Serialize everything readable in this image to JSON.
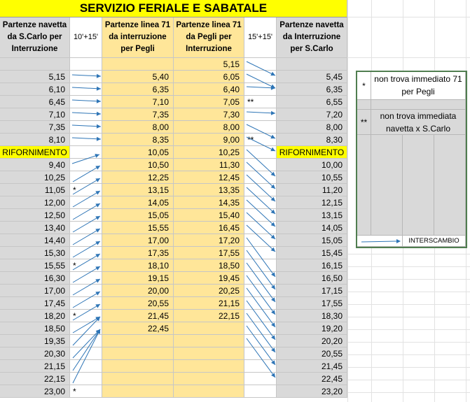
{
  "title": "SERVIZIO FERIALE E SABATALE",
  "headers": {
    "navetta_scarlo": "Partenze navetta da S.Carlo per Interruzione",
    "gap1": "10'+15'",
    "linea71_interruzione": "Partenze linea 71 da interruzione per Pegli",
    "linea71_pegli": "Partenze linea 71 da Pegli per Interruzione",
    "gap2": "15'+15'",
    "navetta_interruzione": "Partenze navetta da Interruzione per S.Carlo"
  },
  "rows": [
    {
      "a": "",
      "m1": "",
      "b": "",
      "c": "5,15",
      "m2": "",
      "d": ""
    },
    {
      "a": "5,15",
      "m1": "",
      "b": "5,40",
      "c": "6,05",
      "m2": "",
      "d": "5,45"
    },
    {
      "a": "6,10",
      "m1": "",
      "b": "6,35",
      "c": "6,40",
      "m2": "",
      "d": "6,35"
    },
    {
      "a": "6,45",
      "m1": "",
      "b": "7,10",
      "c": "7,05",
      "m2": "**",
      "d": "6,55"
    },
    {
      "a": "7,10",
      "m1": "",
      "b": "7,35",
      "c": "7,30",
      "m2": "",
      "d": "7,20"
    },
    {
      "a": "7,35",
      "m1": "",
      "b": "8,00",
      "c": "8,00",
      "m2": "",
      "d": "8,00"
    },
    {
      "a": "8,10",
      "m1": "",
      "b": "8,35",
      "c": "9,00",
      "m2": "**",
      "d": "8,30"
    },
    {
      "a": "RIFORNIMENTO",
      "m1": "",
      "b": "10,05",
      "c": "10,25",
      "m2": "",
      "d": "RIFORNIMENTO"
    },
    {
      "a": "9,40",
      "m1": "",
      "b": "10,50",
      "c": "11,30",
      "m2": "",
      "d": "10,00"
    },
    {
      "a": "10,25",
      "m1": "",
      "b": "12,25",
      "c": "12,45",
      "m2": "",
      "d": "10,55"
    },
    {
      "a": "11,05",
      "m1": "*",
      "b": "13,15",
      "c": "13,35",
      "m2": "",
      "d": "11,20"
    },
    {
      "a": "12,00",
      "m1": "",
      "b": "14,05",
      "c": "14,35",
      "m2": "",
      "d": "12,15"
    },
    {
      "a": "12,50",
      "m1": "",
      "b": "15,05",
      "c": "15,40",
      "m2": "",
      "d": "13,15"
    },
    {
      "a": "13,40",
      "m1": "",
      "b": "15,55",
      "c": "16,45",
      "m2": "",
      "d": "14,05"
    },
    {
      "a": "14,40",
      "m1": "",
      "b": "17,00",
      "c": "17,20",
      "m2": "",
      "d": "15,05"
    },
    {
      "a": "15,30",
      "m1": "",
      "b": "17,35",
      "c": "17,55",
      "m2": "",
      "d": "15,45"
    },
    {
      "a": "15,55",
      "m1": "*",
      "b": "18,10",
      "c": "18,50",
      "m2": "",
      "d": "16,15"
    },
    {
      "a": "16,30",
      "m1": "",
      "b": "19,15",
      "c": "19,45",
      "m2": "",
      "d": "16,50"
    },
    {
      "a": "17,00",
      "m1": "",
      "b": "20,00",
      "c": "20,25",
      "m2": "",
      "d": "17,15"
    },
    {
      "a": "17,45",
      "m1": "",
      "b": "20,55",
      "c": "21,15",
      "m2": "",
      "d": "17,55"
    },
    {
      "a": "18,20",
      "m1": "*",
      "b": "21,45",
      "c": "22,15",
      "m2": "",
      "d": "18,30"
    },
    {
      "a": "18,50",
      "m1": "",
      "b": "22,45",
      "c": "",
      "m2": "",
      "d": "19,20"
    },
    {
      "a": "19,35",
      "m1": "",
      "b": "",
      "c": "",
      "m2": "",
      "d": "20,20"
    },
    {
      "a": "20,30",
      "m1": "",
      "b": "",
      "c": "",
      "m2": "",
      "d": "20,55"
    },
    {
      "a": "21,15",
      "m1": "",
      "b": "",
      "c": "",
      "m2": "",
      "d": "21,45"
    },
    {
      "a": "22,15",
      "m1": "",
      "b": "",
      "c": "",
      "m2": "",
      "d": "22,45"
    },
    {
      "a": "23,00",
      "m1": "*",
      "b": "",
      "c": "",
      "m2": "",
      "d": "23,20"
    }
  ],
  "legend": {
    "items": [
      {
        "symbol": "*",
        "text": "non trova immediato 71 per Pegli"
      },
      {
        "symbol": "**",
        "text": "non trova immediata navetta x S.Carlo"
      }
    ],
    "interchange_label": "INTERSCAMBIO"
  },
  "colors": {
    "title_bg": "#ffff00",
    "linea71_bg": "#ffe699",
    "navetta_bg": "#d9d9d9",
    "arrow": "#2e75b6",
    "legend_border": "#507e50"
  }
}
